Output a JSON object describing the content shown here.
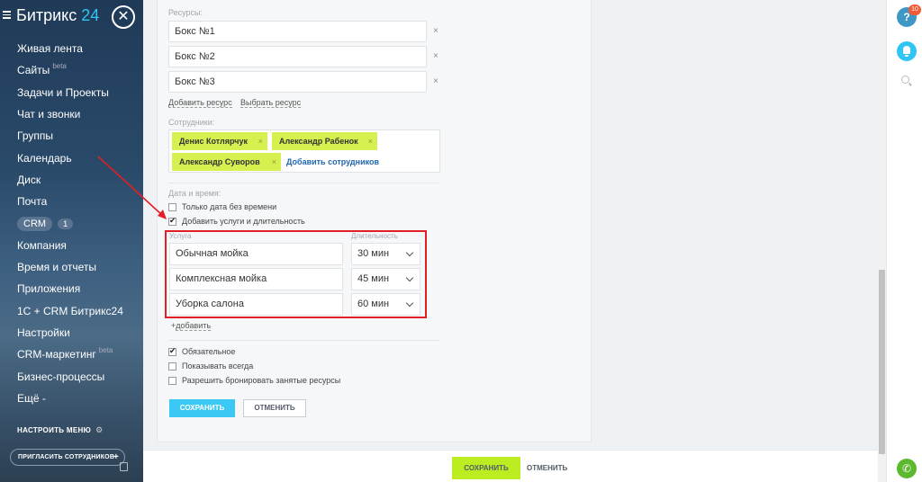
{
  "sidebar": {
    "logo": "Битрикс",
    "logo_num": "24",
    "close_glyph": "✕",
    "items": [
      {
        "label": "Живая лента"
      },
      {
        "label": "Сайты",
        "sup": "beta"
      },
      {
        "label": "Задачи и Проекты"
      },
      {
        "label": "Чат и звонки"
      },
      {
        "label": "Группы"
      },
      {
        "label": "Календарь"
      },
      {
        "label": "Диск"
      },
      {
        "label": "Почта"
      },
      {
        "label": "CRM",
        "count": "1"
      },
      {
        "label": "Компания"
      },
      {
        "label": "Время и отчеты"
      },
      {
        "label": "Приложения"
      },
      {
        "label": "1С + CRM Битрикс24"
      },
      {
        "label": "Настройки"
      },
      {
        "label": "CRM-маркетинг",
        "sup": "beta"
      },
      {
        "label": "Бизнес-процессы"
      },
      {
        "label": "Ещё -"
      }
    ],
    "configure_menu": "НАСТРОИТЬ МЕНЮ",
    "invite": "ПРИГЛАСИТЬ СОТРУДНИКОВ",
    "invite_plus": "+"
  },
  "form": {
    "resources_label": "Ресурсы:",
    "resources": [
      "Бокс №1",
      "Бокс №2",
      "Бокс №3"
    ],
    "remove_glyph": "×",
    "add_resource": "Добавить ресурс",
    "select_resource": "Выбрать ресурс",
    "staff_label": "Сотрудники:",
    "staff": [
      "Денис Котлярчук",
      "Александр Рабенок",
      "Александр Суворов"
    ],
    "add_staff": "Добавить сотрудников",
    "datetime_label": "Дата и время:",
    "only_date": {
      "label": "Только дата без времени",
      "checked": false
    },
    "add_services": {
      "label": "Добавить услуги и длительность",
      "checked": true
    },
    "service_header": "Услуга",
    "duration_header": "Длительность",
    "services": [
      {
        "name": "Обычная мойка",
        "duration": "30 мин"
      },
      {
        "name": "Комплексная мойка",
        "duration": "45 мин"
      },
      {
        "name": "Уборка салона",
        "duration": "60 мин"
      }
    ],
    "add_link": "добавить",
    "add_prefix": "+",
    "required": {
      "label": "Обязательное",
      "checked": true
    },
    "show_always": {
      "label": "Показывать всегда",
      "checked": false
    },
    "allow_busy": {
      "label": "Разрешить бронировать занятые ресурсы",
      "checked": false
    },
    "save": "СОХРАНИТЬ",
    "cancel": "ОТМЕНИТЬ"
  },
  "footer": {
    "save": "СОХРАНИТЬ",
    "cancel": "ОТМЕНИТЬ"
  },
  "right_panel": {
    "help": "?",
    "badge": "10",
    "icons": [
      "help-icon",
      "bell-icon",
      "search-icon",
      "phone-icon"
    ]
  },
  "colors": {
    "accent_blue": "#3bc8f5",
    "accent_green": "#bbed21",
    "tag_green": "#d6f04f",
    "annotation_red": "#e21e26"
  }
}
